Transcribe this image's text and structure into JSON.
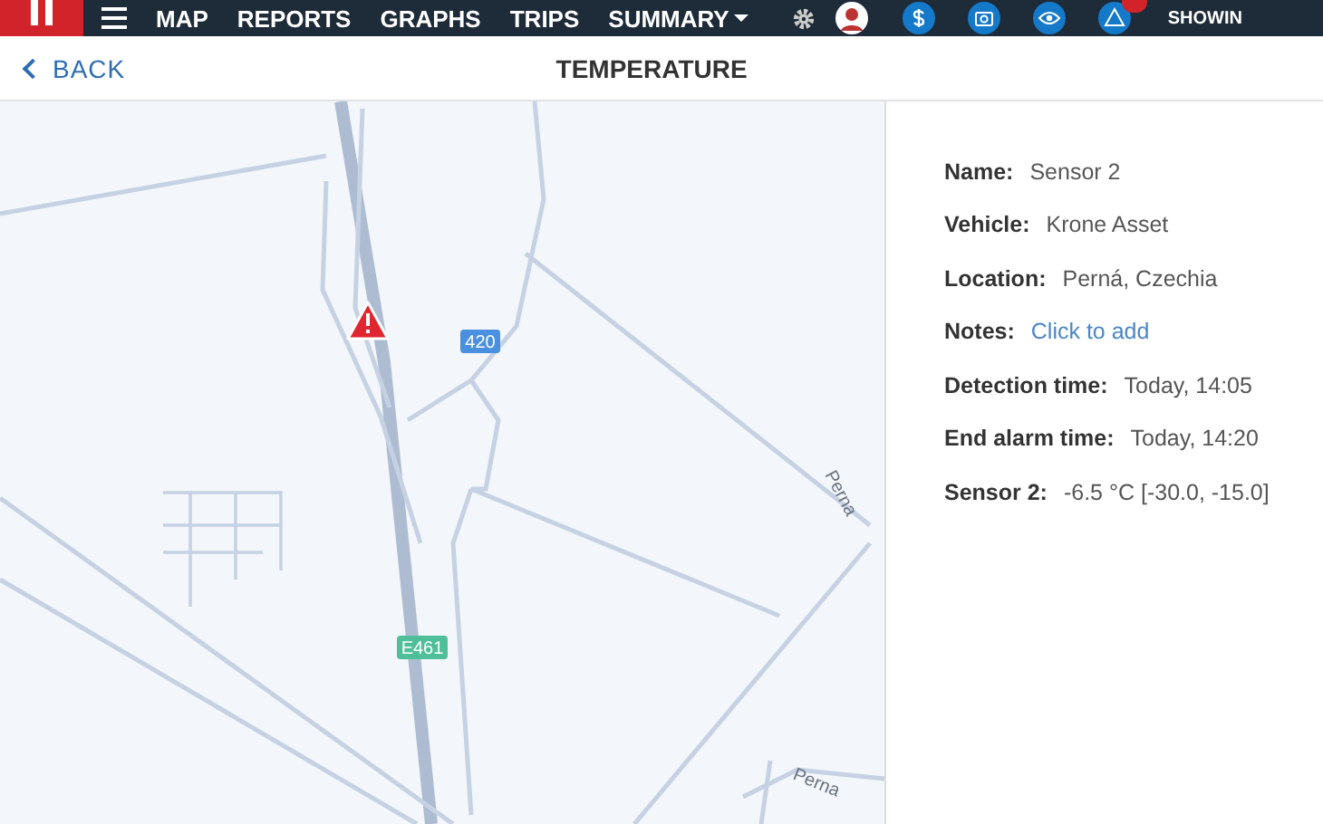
{
  "top_bar": {
    "nav": [
      {
        "label": "MAP"
      },
      {
        "label": "REPORTS"
      },
      {
        "label": "GRAPHS"
      },
      {
        "label": "TRIPS"
      },
      {
        "label": "SUMMARY",
        "dropdown": true
      }
    ],
    "account_label": "SHOWIN"
  },
  "header": {
    "back": "BACK",
    "title": "TEMPERATURE"
  },
  "map": {
    "road_shields": [
      {
        "label": "420",
        "color": "#4a8fe0"
      },
      {
        "label": "E461",
        "color": "#4fbf9a"
      }
    ],
    "place_labels": [
      "Perna",
      "Perna"
    ]
  },
  "details": [
    {
      "label": "Name:",
      "value": "Sensor 2",
      "kind": "text"
    },
    {
      "label": "Vehicle:",
      "value": "Krone Asset",
      "kind": "text"
    },
    {
      "label": "Location:",
      "value": "Perná, Czechia",
      "kind": "text"
    },
    {
      "label": "Notes:",
      "value": "Click to add",
      "kind": "link"
    },
    {
      "label": "Detection time:",
      "value": "Today, 14:05",
      "kind": "text"
    },
    {
      "label": "End alarm time:",
      "value": "Today, 14:20",
      "kind": "text"
    },
    {
      "label": "Sensor 2:",
      "value": "-6.5 °C [-30.0, -15.0]",
      "kind": "text"
    }
  ]
}
